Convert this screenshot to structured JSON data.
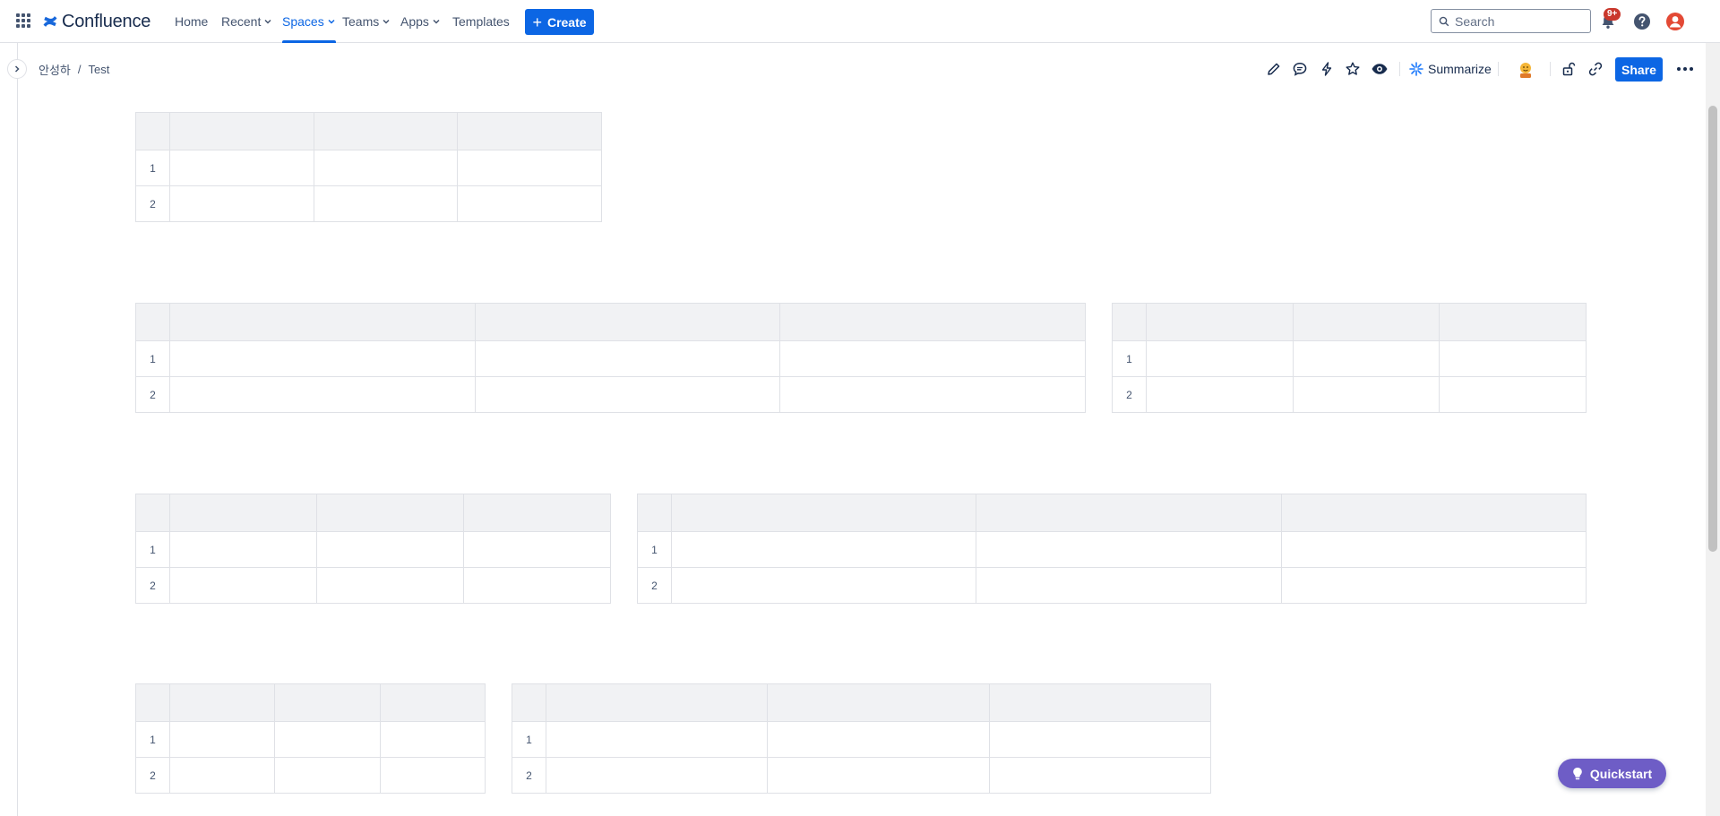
{
  "topnav": {
    "logo_text": "Confluence",
    "items": [
      {
        "label": "Home",
        "dropdown": false
      },
      {
        "label": "Recent",
        "dropdown": true
      },
      {
        "label": "Spaces",
        "dropdown": true,
        "active": true
      },
      {
        "label": "Teams",
        "dropdown": true
      },
      {
        "label": "Apps",
        "dropdown": true
      },
      {
        "label": "Templates",
        "dropdown": false
      }
    ],
    "create_label": "Create",
    "search_placeholder": "Search",
    "notification_badge": "9+"
  },
  "breadcrumb": {
    "space": "안성하",
    "separator": "/",
    "page": "Test"
  },
  "toolbar": {
    "summarize_label": "Summarize",
    "share_label": "Share"
  },
  "tables": [
    {
      "columns": 3,
      "row_numbers": [
        "1",
        "2"
      ]
    },
    {
      "columns": 3,
      "row_numbers": [
        "1",
        "2"
      ]
    },
    {
      "columns": 3,
      "row_numbers": [
        "1",
        "2"
      ]
    },
    {
      "columns": 3,
      "row_numbers": [
        "1",
        "2"
      ]
    },
    {
      "columns": 3,
      "row_numbers": [
        "1",
        "2"
      ]
    },
    {
      "columns": 3,
      "row_numbers": [
        "1",
        "2"
      ]
    },
    {
      "columns": 3,
      "row_numbers": [
        "1",
        "2"
      ]
    }
  ],
  "quickstart_label": "Quickstart",
  "colors": {
    "brand_blue": "#0c66e4",
    "quickstart_purple": "#6e5dc6",
    "badge_red": "#c9372c",
    "table_header_bg": "#f1f2f4"
  }
}
